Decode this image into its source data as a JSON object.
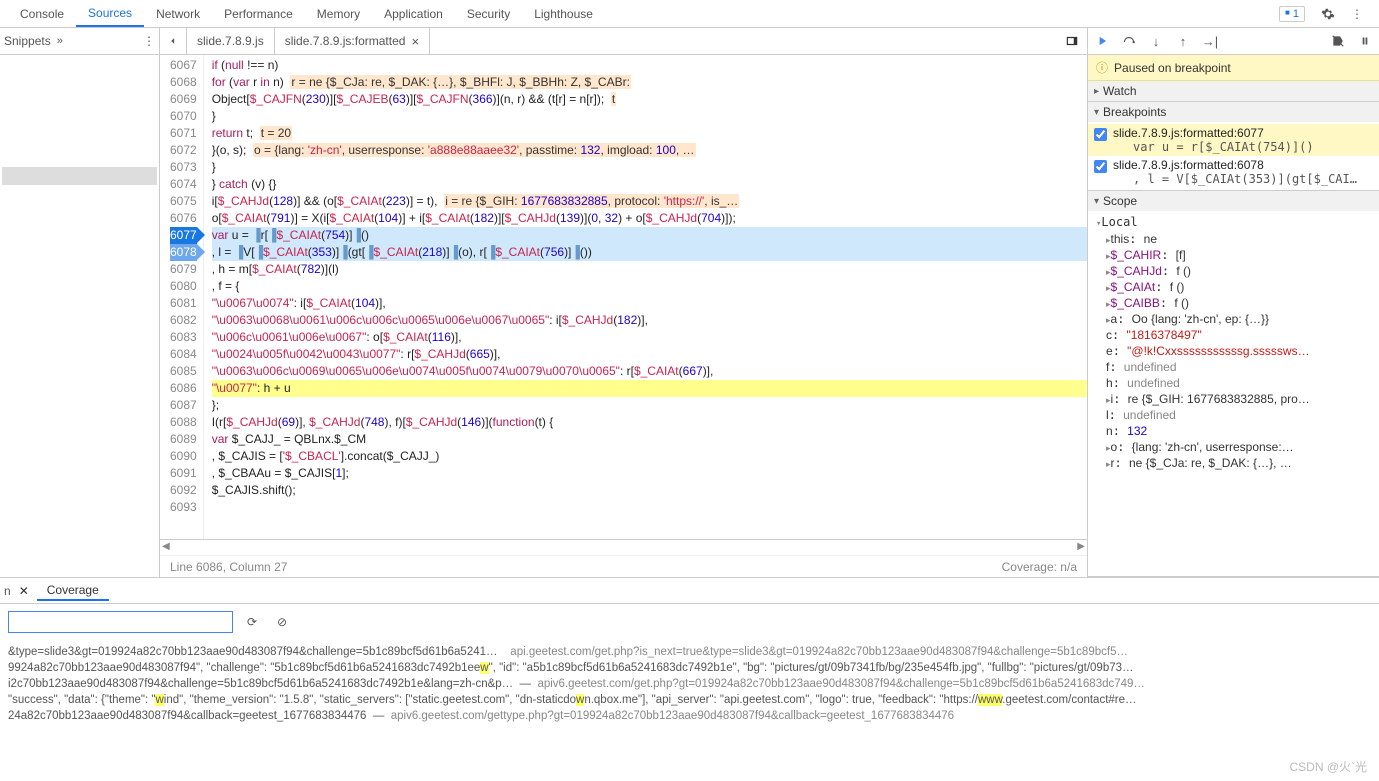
{
  "toolbar": {
    "tabs": [
      "Console",
      "Sources",
      "Network",
      "Performance",
      "Memory",
      "Application",
      "Security",
      "Lighthouse"
    ],
    "active_tab": "Sources",
    "error_count": "1"
  },
  "navigator": {
    "tab_label": "Snippets",
    "items": [
      "·",
      "·",
      "·",
      "·",
      "·",
      "·",
      "·",
      "·"
    ],
    "selected_index": 7
  },
  "file_tabs": {
    "tabs": [
      {
        "label": "slide.7.8.9.js",
        "closable": false
      },
      {
        "label": "slide.7.8.9.js:formatted",
        "closable": true
      }
    ],
    "active_index": 1
  },
  "editor": {
    "first_line": 6067,
    "breakpoint_lines": [
      6077,
      6078
    ],
    "highlight_line": 6086,
    "lines": [
      {
        "n": 6067,
        "html": "                    <span class='kw'>if</span> (<span class='kw'>null</span> !== n)"
      },
      {
        "n": 6068,
        "html": "                        <span class='kw'>for</span> (<span class='kw'>var</span> r <span class='kw'>in</span> n)&nbsp;&nbsp;<span class='obj'>r = ne {$_CJa: re, $_DAK: {…}, $_BHFl: J, $_BBHh: Z, $_CABr:</span>"
      },
      {
        "n": 6069,
        "html": "                            Object[<span class='prop'>$_CAJFN</span>(<span class='num'>230</span>)][<span class='prop'>$_CAJEB</span>(<span class='num'>63</span>)][<span class='prop'>$_CAJFN</span>(<span class='num'>366</span>)](n, r) && (t[r] = n[r]);&nbsp;&nbsp;<span class='obj'>t</span>"
      },
      {
        "n": 6070,
        "html": "                }"
      },
      {
        "n": 6071,
        "html": "                <span class='kw'>return</span> t;&nbsp;&nbsp;<span class='obj'>t = 20</span>"
      },
      {
        "n": 6072,
        "html": "            }(o, s);&nbsp;&nbsp;<span class='obj'>o = {lang: <span class='str'>'zh-cn'</span>, userresponse: <span class='str'>'a888e88aaee32'</span>, passtime: <span class='num'>132</span>, imgload: <span class='num'>100</span>, &hellip;</span>"
      },
      {
        "n": 6073,
        "html": "        }"
      },
      {
        "n": 6074,
        "html": "    } <span class='kw'>catch</span> (v) {}"
      },
      {
        "n": 6075,
        "html": "    i[<span class='prop'>$_CAHJd</span>(<span class='num'>128</span>)] && (o[<span class='prop'>$_CAIAt</span>(<span class='num'>223</span>)] = t),&nbsp;&nbsp;<span class='obj'>i = re {$_GIH: <span class='num'>1677683832885</span>, protocol: <span class='str'>'https://'</span>, is_&hellip;</span>"
      },
      {
        "n": 6076,
        "html": "    o[<span class='prop'>$_CAIAt</span>(<span class='num'>791</span>)] = X(i[<span class='prop'>$_CAIAt</span>(<span class='num'>104</span>)] + i[<span class='prop'>$_CAIAt</span>(<span class='num'>182</span>)][<span class='prop'>$_CAHJd</span>(<span class='num'>139</span>)](<span class='num'>0</span>, <span class='num'>32</span>) + o[<span class='prop'>$_CAHJd</span>(<span class='num'>704</span>)]);"
      },
      {
        "n": 6077,
        "html": "    <span class='kw'>var</span> u = <span class='pipe'>&#9616;</span>r[<span class='pipe'>&#9616;</span><span class='prop'>$_CAIAt</span>(<span class='num'>754</span>)]<span class='pipe'>&#9616;</span>()"
      },
      {
        "n": 6078,
        "html": "      , l = <span class='pipe'>&#9616;</span>V[<span class='pipe'>&#9616;</span><span class='prop'>$_CAIAt</span>(<span class='num'>353</span>)]<span class='pipe'>&#9616;</span>(gt[<span class='pipe'>&#9616;</span><span class='prop'>$_CAIAt</span>(<span class='num'>218</span>)]<span class='pipe'>&#9616;</span>(o), r[<span class='pipe'>&#9616;</span><span class='prop'>$_CAIAt</span>(<span class='num'>756</span>)]<span class='pipe'>&#9616;</span>())"
      },
      {
        "n": 6079,
        "html": "      , h = m[<span class='prop'>$_CAIAt</span>(<span class='num'>782</span>)](l)"
      },
      {
        "n": 6080,
        "html": "      , f = {"
      },
      {
        "n": 6081,
        "html": "        <span class='str'>\"\\u0067\\u0074\"</span>: i[<span class='prop'>$_CAIAt</span>(<span class='num'>104</span>)],"
      },
      {
        "n": 6082,
        "html": "        <span class='str'>\"\\u0063\\u0068\\u0061\\u006c\\u006c\\u0065\\u006e\\u0067\\u0065\"</span>: i[<span class='prop'>$_CAHJd</span>(<span class='num'>182</span>)],"
      },
      {
        "n": 6083,
        "html": "        <span class='str'>\"\\u006c\\u0061\\u006e\\u0067\"</span>: o[<span class='prop'>$_CAIAt</span>(<span class='num'>116</span>)],"
      },
      {
        "n": 6084,
        "html": "        <span class='str'>\"\\u0024\\u005f\\u0042\\u0043\\u0077\"</span>: r[<span class='prop'>$_CAHJd</span>(<span class='num'>665</span>)],"
      },
      {
        "n": 6085,
        "html": "        <span class='str'>\"\\u0063\\u006c\\u0069\\u0065\\u006e\\u0074\\u005f\\u0074\\u0079\\u0070\\u0065\"</span>: r[<span class='prop'>$_CAIAt</span>(<span class='num'>667</span>)],"
      },
      {
        "n": 6086,
        "html": "        <span class='str'>\"\\u0077\"</span>: h + u"
      },
      {
        "n": 6087,
        "html": "    };"
      },
      {
        "n": 6088,
        "html": "    I(r[<span class='prop'>$_CAHJd</span>(<span class='num'>69</span>)], <span class='prop'>$_CAHJd</span>(<span class='num'>748</span>), f)[<span class='prop'>$_CAHJd</span>(<span class='num'>146</span>)](<span class='kw'>function</span>(t) {"
      },
      {
        "n": 6089,
        "html": "        <span class='kw'>var</span> $_CAJJ_ = QBLnx.$_CM"
      },
      {
        "n": 6090,
        "html": "          , $_CAJIS = [<span class='str'>'$_CBACL'</span>].concat($_CAJJ_)"
      },
      {
        "n": 6091,
        "html": "          , $_CBAAu = $_CAJIS[<span class='num'>1</span>];"
      },
      {
        "n": 6092,
        "html": "        $_CAJIS.shift();"
      },
      {
        "n": 6093,
        "html": "&nbsp;"
      }
    ],
    "status_left": "Line 6086, Column 27",
    "status_right": "Coverage: n/a"
  },
  "debugger": {
    "paused_msg": "Paused on breakpoint",
    "sections": {
      "watch": "Watch",
      "breakpoints": "Breakpoints",
      "scope": "Scope"
    },
    "breakpoints": [
      {
        "loc": "slide.7.8.9.js:formatted:6077",
        "code": "var u = r[$_CAIAt(754)]()",
        "active": true
      },
      {
        "loc": "slide.7.8.9.js:formatted:6078",
        "code": ", l = V[$_CAIAt(353)](gt[$_CAI…",
        "active": false
      }
    ],
    "scope_header": "Local",
    "scope_items": [
      {
        "k": "this",
        "v": "ne",
        "arrow": true
      },
      {
        "k": "$_CAHIR",
        "v": "[f]",
        "cls": "k",
        "arrow": true
      },
      {
        "k": "$_CAHJd",
        "v": "f ()",
        "cls": "k",
        "arrow": true
      },
      {
        "k": "$_CAIAt",
        "v": "f ()",
        "cls": "k",
        "arrow": true
      },
      {
        "k": "$_CAIBB",
        "v": "f ()",
        "cls": "k",
        "arrow": true
      },
      {
        "k": "a",
        "v": "Oo {lang: 'zh-cn', ep: {…}}",
        "arrow": true
      },
      {
        "k": "c",
        "v": "\"1816378497\"",
        "vs": true
      },
      {
        "k": "e",
        "v": "\"@!k!Cxxsssssssssssg.sssssws…",
        "vs": true
      },
      {
        "k": "f",
        "v": "undefined",
        "vu": true
      },
      {
        "k": "h",
        "v": "undefined",
        "vu": true
      },
      {
        "k": "i",
        "v": "re {$_GIH: 1677683832885, pro…",
        "arrow": true
      },
      {
        "k": "l",
        "v": "undefined",
        "vu": true
      },
      {
        "k": "n",
        "v": "132",
        "vn": true
      },
      {
        "k": "o",
        "v": "{lang: 'zh-cn', userresponse:…",
        "arrow": true
      },
      {
        "k": "r",
        "v": "ne {$_CJa: re, $_DAK: {…}, …",
        "arrow": true
      }
    ]
  },
  "drawer": {
    "tab": "Coverage",
    "lines": [
      "&amp;type=slide3&amp;gt=019924a82c70bb123aae90d483087f94&amp;challenge=5b1c89bcf5d61b6a5241… &nbsp;&nbsp; <span class='url'>api.geetest.com/get.php?is_next=true&amp;type=slide3&amp;gt=019924a82c70bb123aae90d483087f94&amp;challenge=5b1c89bcf5…</span>",
      "9924a82c70bb123aae90d483087f94\", \"challenge\": \"5b1c89bcf5d61b6a5241683dc7492b1ee<span class='hlmark'>w</span>\", \"id\": \"a5b1c89bcf5d61b6a5241683dc7492b1e\", \"bg\": \"pictures/gt/09b7341fb/bg/235e454fb.jpg\", \"fullbg\": \"pictures/gt/09b73…",
      "i2c70bb123aae90d483087f94&amp;challenge=5b1c89bcf5d61b6a5241683dc7492b1e&amp;lang=zh-cn&amp;p… &nbsp;—&nbsp; <span class='url'>apiv6.geetest.com/get.php?gt=019924a82c70bb123aae90d483087f94&amp;challenge=5b1c89bcf5d61b6a5241683dc749…</span>",
      "\"success\", \"data\": {\"theme\": \"<span class='hlmark'>w</span>ind\", \"theme_version\": \"1.5.8\", \"static_servers\": [\"static.geetest.com\", \"dn-staticdo<span class='hlmark'>w</span>n.qbox.me\"], \"api_server\": \"api.geetest.com\", \"logo\": true, \"feedback\": \"https://<span class='hlmark'>www</span>.geetest.com/contact#re…",
      "24a82c70bb123aae90d483087f94&amp;callback=geetest_1677683834476 &nbsp;—&nbsp; <span class='url'>apiv6.geetest.com/gettype.php?gt=019924a82c70bb123aae90d483087f94&amp;callback=geetest_1677683834476</span>"
    ]
  },
  "watermark": "CSDN @火`光"
}
